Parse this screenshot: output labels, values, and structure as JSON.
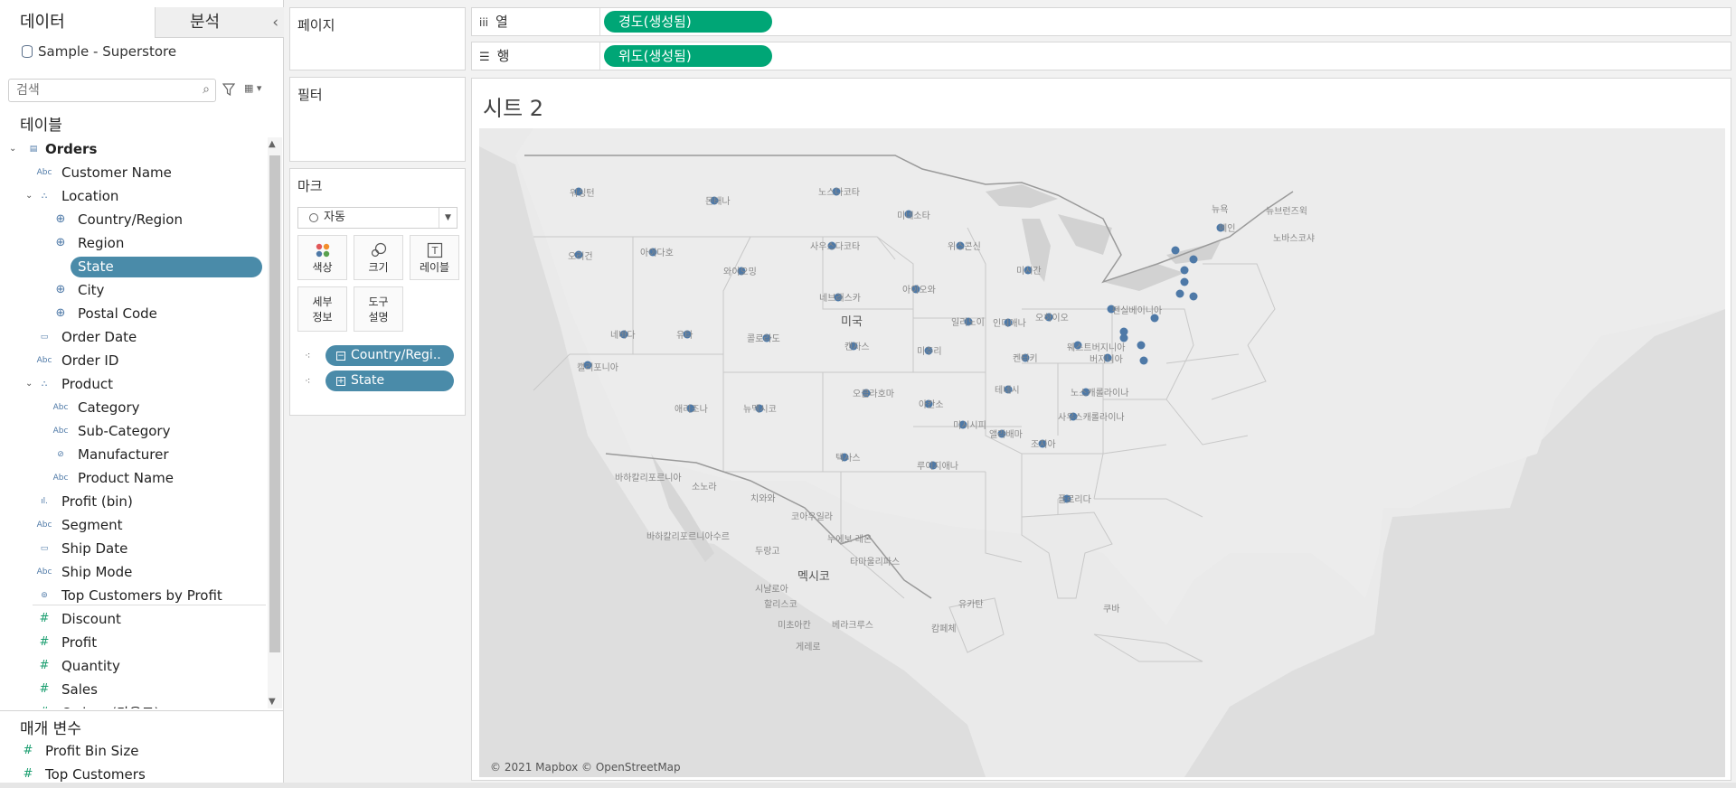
{
  "tabs": {
    "data": "데이터",
    "analytics": "분석"
  },
  "datasource": "Sample - Superstore",
  "search": {
    "placeholder": "검색"
  },
  "tables_title": "테이블",
  "fields": [
    {
      "label": "Orders",
      "icon": "table-icon",
      "indent": 0,
      "bold": true,
      "caret": "⊟",
      "type": "table"
    },
    {
      "label": "Customer Name",
      "icon": "Abc",
      "indent": 1,
      "type": "dim"
    },
    {
      "label": "Location",
      "icon": "hierarchy-icon",
      "indent": 1,
      "caret": "v",
      "type": "hier"
    },
    {
      "label": "Country/Region",
      "icon": "globe-icon",
      "indent": 2,
      "type": "geo"
    },
    {
      "label": "Region",
      "icon": "globe-icon",
      "indent": 2,
      "type": "geo"
    },
    {
      "label": "State",
      "icon": "globe-icon",
      "indent": 2,
      "type": "geo",
      "selected": true
    },
    {
      "label": "City",
      "icon": "globe-icon",
      "indent": 2,
      "type": "geo"
    },
    {
      "label": "Postal Code",
      "icon": "globe-icon",
      "indent": 2,
      "type": "geo"
    },
    {
      "label": "Order Date",
      "icon": "calendar-icon",
      "indent": 1,
      "type": "date"
    },
    {
      "label": "Order ID",
      "icon": "Abc",
      "indent": 1,
      "type": "dim"
    },
    {
      "label": "Product",
      "icon": "hierarchy-icon",
      "indent": 1,
      "caret": "v",
      "type": "hier"
    },
    {
      "label": "Category",
      "icon": "Abc",
      "indent": 2,
      "type": "dim"
    },
    {
      "label": "Sub-Category",
      "icon": "Abc",
      "indent": 2,
      "type": "dim"
    },
    {
      "label": "Manufacturer",
      "icon": "clip-icon",
      "indent": 2,
      "type": "group"
    },
    {
      "label": "Product Name",
      "icon": "Abc",
      "indent": 2,
      "type": "dim"
    },
    {
      "label": "Profit (bin)",
      "icon": "bin-icon",
      "indent": 1,
      "type": "bin"
    },
    {
      "label": "Segment",
      "icon": "Abc",
      "indent": 1,
      "type": "dim"
    },
    {
      "label": "Ship Date",
      "icon": "calendar-icon",
      "indent": 1,
      "type": "date"
    },
    {
      "label": "Ship Mode",
      "icon": "Abc",
      "indent": 1,
      "type": "dim"
    },
    {
      "label": "Top Customers by Profit",
      "icon": "set-icon",
      "indent": 1,
      "type": "set"
    },
    {
      "label": "Discount",
      "icon": "#",
      "indent": 1,
      "type": "num"
    },
    {
      "label": "Profit",
      "icon": "#",
      "indent": 1,
      "type": "num"
    },
    {
      "label": "Quantity",
      "icon": "#",
      "indent": 1,
      "type": "num"
    },
    {
      "label": "Sales",
      "icon": "#",
      "indent": 1,
      "type": "num"
    },
    {
      "label": "Orders (카운트)",
      "icon": "#",
      "indent": 1,
      "type": "num"
    }
  ],
  "params_title": "매개 변수",
  "params": [
    {
      "label": "Profit Bin Size",
      "icon": "#"
    },
    {
      "label": "Top Customers",
      "icon": "#"
    }
  ],
  "cards": {
    "pages": "페이지",
    "filters": "필터",
    "marks": "마크",
    "mark_type": "자동",
    "mark_buttons": [
      {
        "label": "색상",
        "icon": "color-icon"
      },
      {
        "label": "크기",
        "icon": "size-icon"
      },
      {
        "label": "레이블",
        "icon": "label-icon"
      },
      {
        "label": "세부\n정보",
        "icon": "detail-icon"
      },
      {
        "label": "도구\n설명",
        "icon": "tooltip-icon"
      }
    ],
    "mark_pills": [
      "Country/Regi..",
      "State"
    ]
  },
  "shelves": {
    "columns": {
      "label": "열",
      "pill": "경도(생성됨)"
    },
    "rows": {
      "label": "행",
      "pill": "위도(생성됨)"
    }
  },
  "sheet_title": "시트 2",
  "attribution": "© 2021 Mapbox © OpenStreetMap",
  "map_labels": [
    "워싱턴",
    "몬태나",
    "노스다코타",
    "미네소타",
    "오리건",
    "아이다호",
    "사우스다코타",
    "위스콘신",
    "미시간",
    "뉴욕",
    "메인",
    "와이오밍",
    "아이오와",
    "네브래스카",
    "미국",
    "펜실베이니아",
    "네바다",
    "유타",
    "콜로라도",
    "캔자스",
    "미주리",
    "일리노이",
    "인디애나",
    "오하이오",
    "캘리포니아",
    "켄터키",
    "웨스트버지니아",
    "버지니아",
    "테네시",
    "노스캐롤라이나",
    "오클라호마",
    "애리조나",
    "뉴멕시코",
    "아칸소",
    "사우스캐롤라이나",
    "미시시피",
    "앨라배마",
    "조지아",
    "텍사스",
    "루이지애나",
    "플로리다",
    "바하칼리포르니아",
    "소노라",
    "치와와",
    "코아우일라",
    "누에보 레온",
    "바하칼리포르니아수르",
    "두랑고",
    "타마울리파스",
    "멕시코",
    "시날로아",
    "할리스코",
    "미초아칸",
    "베라크루스",
    "유카탄",
    "쿠바",
    "노바스코샤",
    "뉴브런즈윅",
    "캄페체",
    "게레로"
  ],
  "colors": {
    "accent_blue": "#4a8ba9",
    "accent_green": "#00a676",
    "dot": "#4e79a7"
  }
}
